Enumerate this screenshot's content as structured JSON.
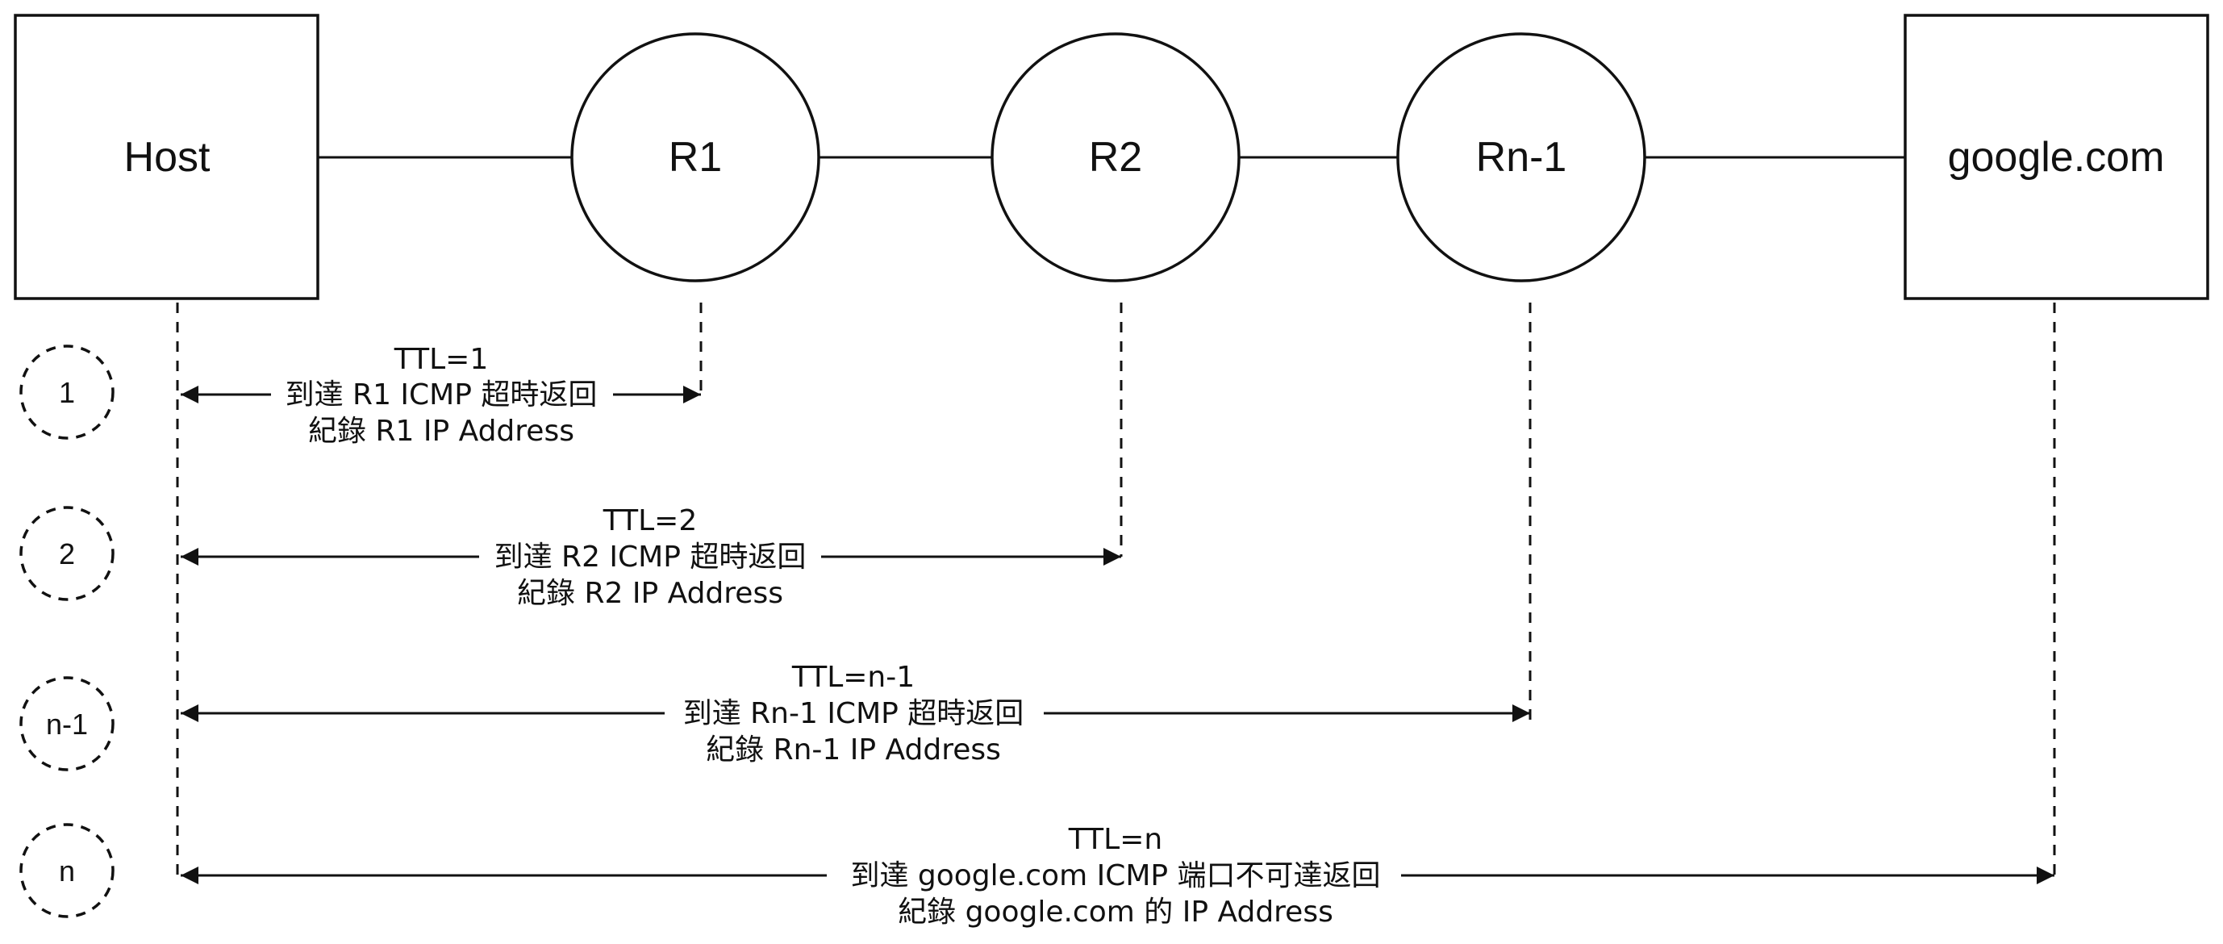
{
  "nodes": {
    "host": {
      "label": "Host"
    },
    "r1": {
      "label": "R1"
    },
    "r2": {
      "label": "R2"
    },
    "rn1": {
      "label": "Rn-1"
    },
    "google": {
      "label": "google.com"
    }
  },
  "steps": [
    {
      "label": "1",
      "lines": [
        "TTL=1",
        "到達 R1 ICMP 超時返回",
        "紀錄 R1 IP Address"
      ]
    },
    {
      "label": "2",
      "lines": [
        "TTL=2",
        "到達 R2 ICMP 超時返回",
        "紀錄 R2 IP Address"
      ]
    },
    {
      "label": "n-1",
      "lines": [
        "TTL=n-1",
        "到達 Rn-1 ICMP 超時返回",
        "紀錄 Rn-1 IP Address"
      ]
    },
    {
      "label": "n",
      "lines": [
        "TTL=n",
        "到達 google.com ICMP 端口不可達返回",
        "紀錄 google.com 的 IP Address"
      ]
    }
  ]
}
